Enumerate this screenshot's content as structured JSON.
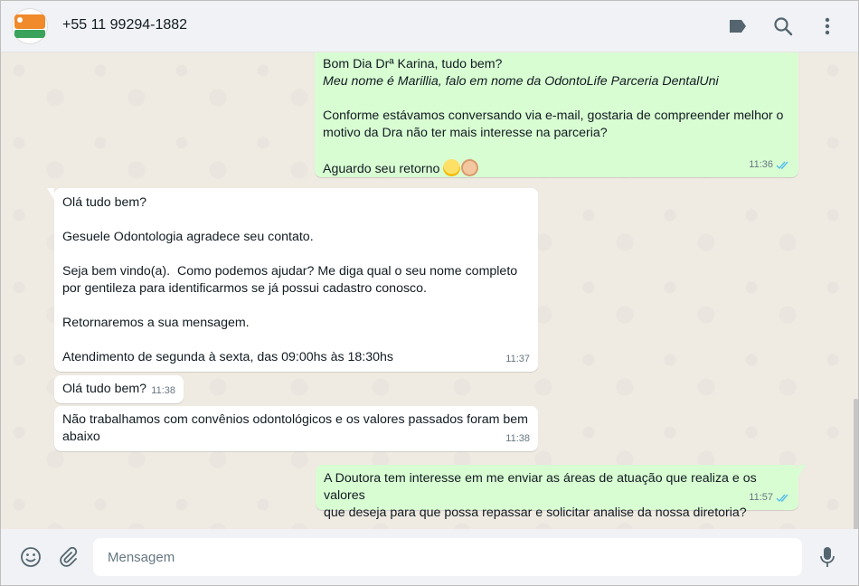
{
  "header": {
    "contact_name": "+55 11 99294-1882",
    "icons": [
      "tag-icon",
      "search-icon",
      "more-vertical-icon"
    ]
  },
  "messages": [
    {
      "direction": "outgoing",
      "lines": [
        "Bom Dia Drª Karina, tudo bem?",
        "Meu nome é Marillia, falo em nome da OdontoLife Parceria DentalUni",
        "",
        "Conforme estávamos conversando via e-mail, gostaria de compreender melhor o",
        "motivo da Dra não ter mais interesse na parceria?",
        "",
        "Aguardo seu retorno"
      ],
      "italic_line": "Meu nome é Marillia, falo em nome da OdontoLife Parceria DentalUni",
      "time": "11:36",
      "status": "read-double-check"
    },
    {
      "direction": "incoming",
      "text": "Olá tudo bem?\n\nGesuele Odontologia agradece seu contato.\n\nSeja bem vindo(a).  Como podemos ajudar? Me diga qual o seu nome completo\npor gentileza para identificarmos se já possui cadastro conosco.\n\nRetornaremos a sua mensagem.\n\nAtendimento de segunda à sexta, das 09:00hs às 18:30hs",
      "time": "11:37"
    },
    {
      "direction": "incoming",
      "text": "Olá tudo bem?",
      "time": "11:38"
    },
    {
      "direction": "incoming",
      "text": "Não trabalhamos com convênios odontológicos e os valores passados foram bem\nabaixo",
      "time": "11:38"
    },
    {
      "direction": "outgoing",
      "text": "A Doutora tem interesse em me enviar as áreas de atuação que realiza e os valores\nque deseja para que possa repassar e solicitar analise da nossa diretoria?",
      "time": "11:57",
      "status": "read-double-check"
    }
  ],
  "composer": {
    "placeholder": "Mensagem",
    "value": ""
  },
  "colors": {
    "outgoing_bubble": "#d9fdd3",
    "incoming_bubble": "#ffffff",
    "chat_background": "#efeae2",
    "read_check": "#53bdeb",
    "header_bg": "#f0f2f5"
  }
}
